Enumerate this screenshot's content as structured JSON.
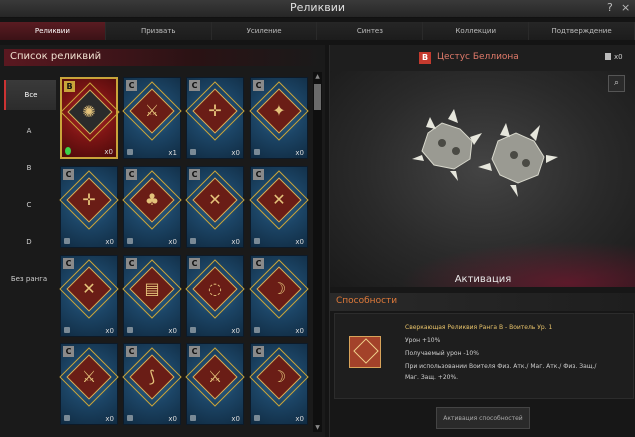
{
  "window": {
    "title": "Реликвии",
    "help_icon": "?",
    "close_icon": "×"
  },
  "tabs": [
    "Реликвии",
    "Призвать",
    "Усиление",
    "Синтез",
    "Коллекции",
    "Подтверждение"
  ],
  "list": {
    "title": "Список реликвий",
    "filters": [
      "Все",
      "A",
      "B",
      "C",
      "D",
      "Без ранга"
    ]
  },
  "cards": [
    {
      "grade": "B",
      "icon": "cestus-icon",
      "count": "x0"
    },
    {
      "grade": "C",
      "icon": "axe-icon",
      "count": "x1"
    },
    {
      "grade": "C",
      "icon": "crossbow-icon",
      "count": "x0"
    },
    {
      "grade": "C",
      "icon": "dagger-icon",
      "count": "x0"
    },
    {
      "grade": "C",
      "icon": "crossbow-icon",
      "count": "x0"
    },
    {
      "grade": "C",
      "icon": "mace-icon",
      "count": "x0"
    },
    {
      "grade": "C",
      "icon": "dual-swords-icon",
      "count": "x0"
    },
    {
      "grade": "C",
      "icon": "dual-swords-icon",
      "count": "x0"
    },
    {
      "grade": "C",
      "icon": "dual-swords-icon",
      "count": "x0"
    },
    {
      "grade": "C",
      "icon": "hammer-icon",
      "count": "x0"
    },
    {
      "grade": "C",
      "icon": "chakram-icon",
      "count": "x0"
    },
    {
      "grade": "C",
      "icon": "bow-icon",
      "count": "x0"
    },
    {
      "grade": "C",
      "icon": "axe-icon",
      "count": "x0"
    },
    {
      "grade": "C",
      "icon": "scythe-icon",
      "count": "x0"
    },
    {
      "grade": "C",
      "icon": "axe-icon",
      "count": "x0"
    },
    {
      "grade": "C",
      "icon": "bow-icon",
      "count": "x0"
    }
  ],
  "detail": {
    "grade": "B",
    "name": "Цестус Беллиона",
    "owned": "x0",
    "activation_label": "Активация"
  },
  "abilities": {
    "header": "Способности",
    "title": "Сверкающая Реликвия Ранга B - Воитель Ур. 1",
    "lines": [
      "Урон +10%",
      "Получаемый урон -10%",
      "При использовании Воителя Физ. Атк./ Маг. Атк./ Физ. Защ./",
      "Маг. Защ. +20%."
    ],
    "button": "Активация способностей"
  }
}
